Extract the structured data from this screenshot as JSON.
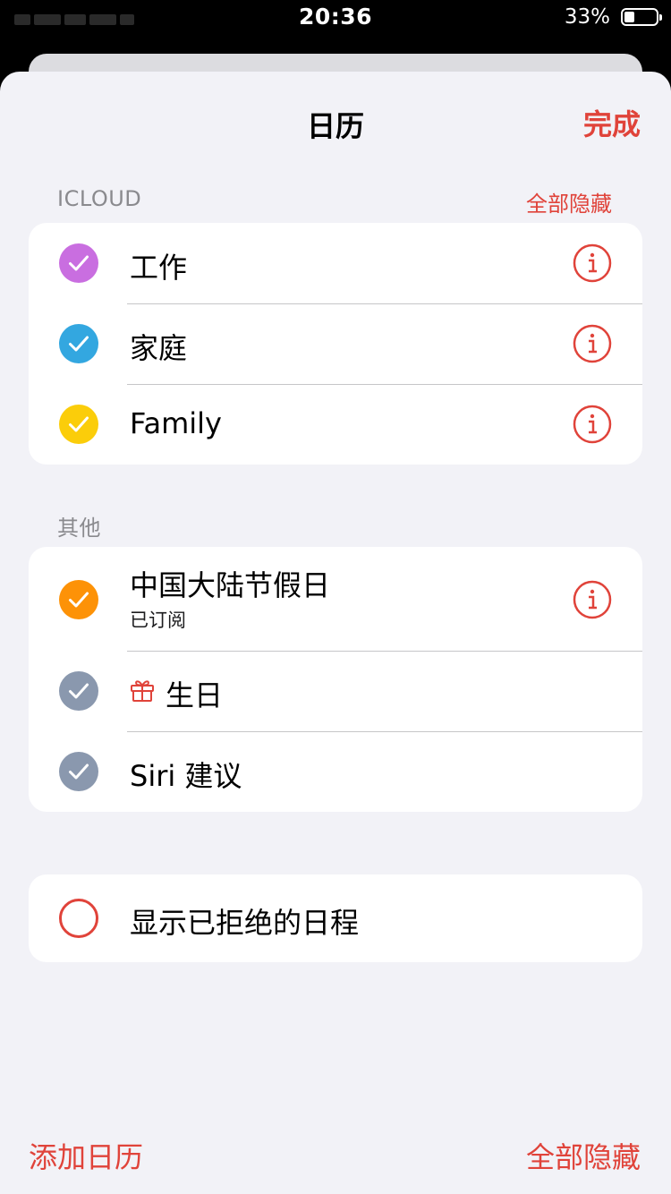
{
  "status_bar": {
    "time": "20:36",
    "battery_percent_label": "33%",
    "battery_level": 0.33
  },
  "nav": {
    "title": "日历",
    "done_label": "完成"
  },
  "icloud": {
    "header": "ICLOUD",
    "hide_all_label": "全部隐藏",
    "calendars": [
      {
        "name": "工作",
        "color": "#c96ee0",
        "checked": true,
        "info_icon": "info-circle-icon"
      },
      {
        "name": "家庭",
        "color": "#33a7e0",
        "checked": true,
        "info_icon": "info-circle-icon"
      },
      {
        "name": "Family",
        "color": "#fbcd0a",
        "checked": true,
        "info_icon": "info-circle-icon"
      }
    ]
  },
  "other": {
    "header": "其他",
    "calendars": [
      {
        "name": "中国大陆节假日",
        "subtitle": "已订阅",
        "color": "#fd9207",
        "checked": true,
        "info_icon": "info-circle-icon"
      },
      {
        "name": "生日",
        "color": "#8a98ae",
        "checked": true,
        "leading_icon": "gift-icon"
      },
      {
        "name": "Siri 建议",
        "color": "#8a98ae",
        "checked": true
      }
    ]
  },
  "declined": {
    "label": "显示已拒绝的日程",
    "checked": false
  },
  "footer": {
    "add_calendar_label": "添加日历",
    "hide_all_label": "全部隐藏"
  },
  "colors": {
    "accent": "#e0433a",
    "background": "#f2f2f7",
    "card": "#ffffff",
    "separator": "#c6c6c8"
  }
}
